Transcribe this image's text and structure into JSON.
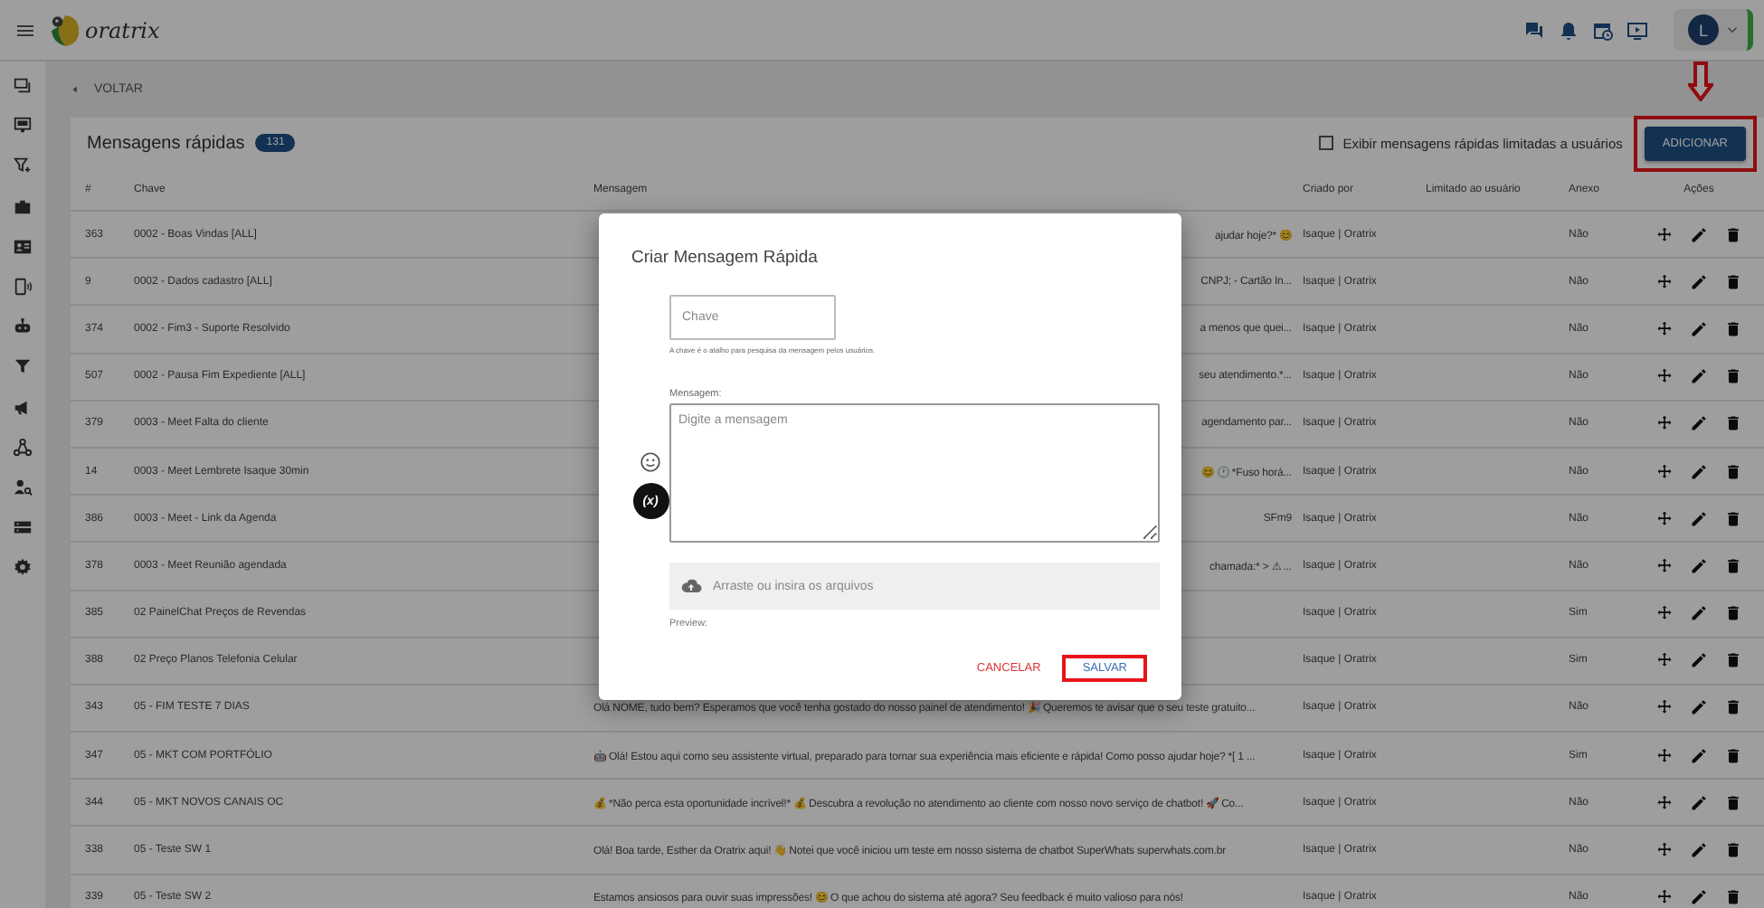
{
  "header": {
    "logo_text": "oratrix",
    "avatar_initial": "L"
  },
  "back_link": "VOLTAR",
  "panel": {
    "title": "Mensagens rápidas",
    "badge": "131",
    "filter_checkbox": {
      "label": "Exibir mensagens rápidas limitadas a usuários",
      "checked": false
    },
    "add_button": {
      "label": "ADICIONAR",
      "highlighted": true
    }
  },
  "table": {
    "columns": [
      "#",
      "Chave",
      "Mensagem",
      "Criado por",
      "Limitado ao usuário",
      "Anexo",
      "Ações"
    ],
    "rows": [
      {
        "id": "363",
        "key": "0002 - Boas Vindas [ALL]",
        "message_end": "ajudar hoje?* 😊",
        "created_by": "Isaque | Oratrix",
        "attachment": "Não"
      },
      {
        "id": "9",
        "key": "0002 - Dados cadastro [ALL]",
        "message_end": "CNPJ; - Cartão In...",
        "created_by": "Isaque | Oratrix",
        "attachment": "Não"
      },
      {
        "id": "374",
        "key": "0002 - Fim3 - Suporte Resolvido",
        "message_end": "a menos que quei...",
        "created_by": "Isaque | Oratrix",
        "attachment": "Não"
      },
      {
        "id": "507",
        "key": "0002 - Pausa Fim Expediente [ALL]",
        "message_end": "seu atendimento.*...",
        "created_by": "Isaque | Oratrix",
        "attachment": "Não"
      },
      {
        "id": "379",
        "key": "0003 - Meet Falta do cliente",
        "message_end": "agendamento par...",
        "created_by": "Isaque | Oratrix",
        "attachment": "Não"
      },
      {
        "id": "14",
        "key": "0003 - Meet Lembrete Isaque 30min",
        "message_end": "😊 🕐 *Fuso horá...",
        "created_by": "Isaque | Oratrix",
        "attachment": "Não"
      },
      {
        "id": "386",
        "key": "0003 - Meet - Link da Agenda",
        "message_end": "SFm9",
        "created_by": "Isaque | Oratrix",
        "attachment": "Não"
      },
      {
        "id": "378",
        "key": "0003 - Meet Reunião agendada",
        "message_end": "chamada:* > ⚠ ...",
        "created_by": "Isaque | Oratrix",
        "attachment": "Não"
      },
      {
        "id": "385",
        "key": "02 PainelChat Preços de Revendas",
        "created_by": "Isaque | Oratrix",
        "attachment": "Sim"
      },
      {
        "id": "388",
        "key": "02 Preço Planos Telefonia Celular",
        "created_by": "Isaque | Oratrix",
        "attachment": "Sim"
      },
      {
        "id": "343",
        "key": "05 - FIM TESTE 7 DIAS",
        "message": "Olá NOME, tudo bem? Esperamos que você tenha gostado do nosso painel de atendimento! 🎉 Queremos te avisar que o seu teste gratuito...",
        "created_by": "Isaque | Oratrix",
        "attachment": "Não"
      },
      {
        "id": "347",
        "key": "05 - MKT COM PORTFÓLIO",
        "message": "🤖 Olá! Estou aqui como seu assistente virtual, preparado para tornar sua experiência mais eficiente e rápida! Como posso ajudar hoje? *[ 1 ...",
        "created_by": "Isaque | Oratrix",
        "attachment": "Sim"
      },
      {
        "id": "344",
        "key": "05 - MKT NOVOS CANAIS OC",
        "message": "💰 *Não perca esta oportunidade incrível!* 💰 Descubra a revolução no atendimento ao cliente com nosso novo serviço de chatbot! 🚀 Co...",
        "created_by": "Isaque | Oratrix",
        "attachment": "Não"
      },
      {
        "id": "338",
        "key": "05 - Teste SW 1",
        "message": "Olá! Boa tarde, Esther da Oratrix aqui! 👋 Notei que você iniciou um teste em nosso sistema de chatbot SuperWhats superwhats.com.br",
        "created_by": "Isaque | Oratrix",
        "attachment": "Não"
      },
      {
        "id": "339",
        "key": "05 - Teste SW 2",
        "message": "Estamos ansiosos para ouvir suas impressões! 😊 O que achou do sistema até agora? Seu feedback é muito valioso para nós!",
        "created_by": "Isaque | Oratrix",
        "attachment": "Não"
      }
    ]
  },
  "dialog": {
    "title": "Criar Mensagem Rápida",
    "key_field": {
      "placeholder": "Chave",
      "hint": "A chave é o atalho para pesquisa da mensagem pelos usuários."
    },
    "message_field": {
      "label": "Mensagem:",
      "placeholder": "Digite a mensagem"
    },
    "variable_button": "(x)",
    "upload": "Arraste ou insira os arquivos",
    "preview_label": "Preview:",
    "cancel_button": "CANCELAR",
    "save_button": {
      "label": "SALVAR",
      "highlighted": true
    }
  }
}
